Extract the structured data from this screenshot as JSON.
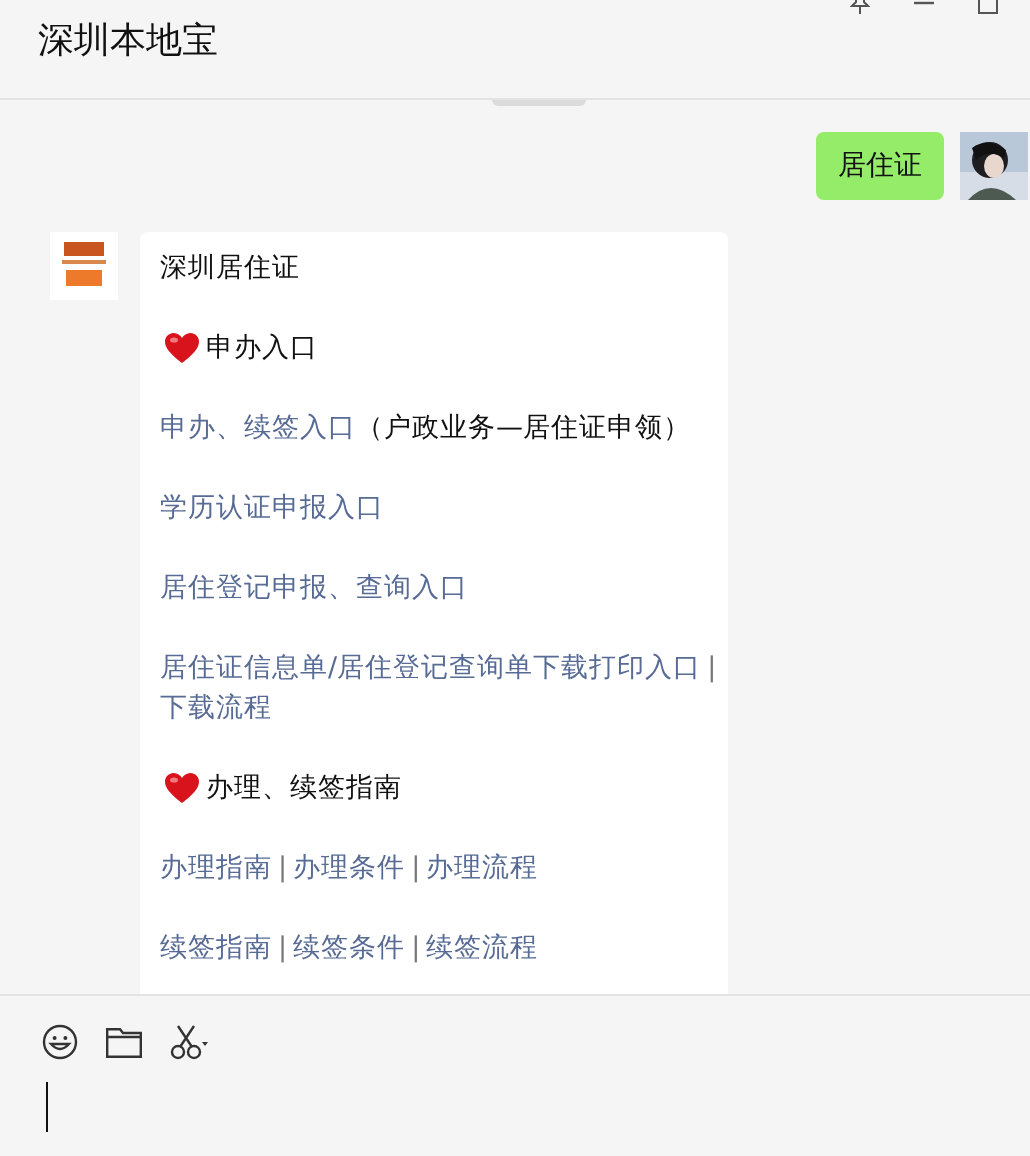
{
  "window": {
    "title": "深圳本地宝"
  },
  "messages": [
    {
      "kind": "sent",
      "text": "居住证"
    },
    {
      "kind": "received",
      "paragraphs": [
        {
          "kind": "title",
          "parts": [
            {
              "kind": "plain",
              "text": "深圳居住证"
            }
          ]
        },
        {
          "kind": "heading",
          "parts": [
            {
              "kind": "plain",
              "text": "申办入口"
            }
          ]
        },
        {
          "kind": "body",
          "parts": [
            {
              "kind": "link",
              "text": "申办、续签入口"
            },
            {
              "kind": "plain",
              "text": "（户政业务—居住证申领）"
            }
          ]
        },
        {
          "kind": "body",
          "parts": [
            {
              "kind": "link",
              "text": "学历认证申报入口"
            }
          ]
        },
        {
          "kind": "body",
          "parts": [
            {
              "kind": "link",
              "text": "居住登记申报、查询入口"
            }
          ]
        },
        {
          "kind": "body",
          "parts": [
            {
              "kind": "link",
              "text": "居住证信息单/居住登记查询单下载打印入口"
            },
            {
              "kind": "separator",
              "text": "|"
            },
            {
              "kind": "link",
              "text": "下载流程"
            }
          ]
        },
        {
          "kind": "heading",
          "parts": [
            {
              "kind": "plain",
              "text": "办理、续签指南"
            }
          ]
        },
        {
          "kind": "body",
          "parts": [
            {
              "kind": "link",
              "text": "办理指南"
            },
            {
              "kind": "separator",
              "text": "|"
            },
            {
              "kind": "link",
              "text": "办理条件"
            },
            {
              "kind": "separator",
              "text": "|"
            },
            {
              "kind": "link",
              "text": "办理流程"
            }
          ]
        },
        {
          "kind": "body",
          "parts": [
            {
              "kind": "link",
              "text": "续签指南"
            },
            {
              "kind": "separator",
              "text": "|"
            },
            {
              "kind": "link",
              "text": "续签条件"
            },
            {
              "kind": "separator",
              "text": "|"
            },
            {
              "kind": "link",
              "text": "续签流程"
            }
          ]
        }
      ]
    }
  ]
}
